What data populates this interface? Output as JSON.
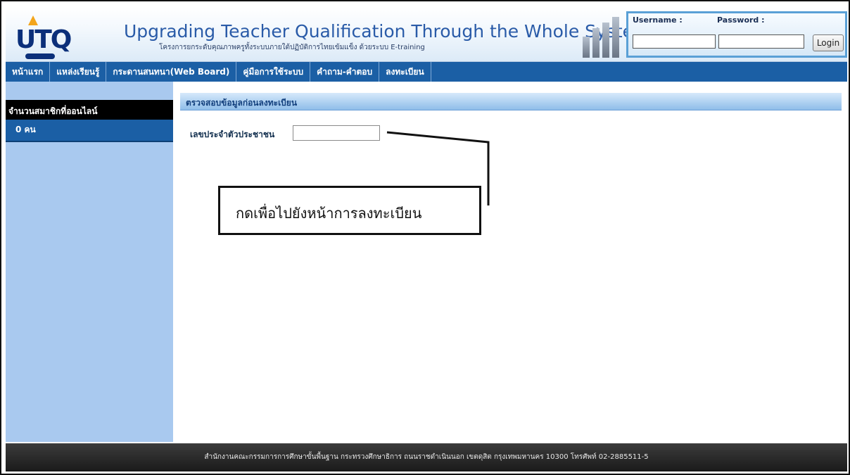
{
  "header": {
    "logo_text": "UTQ",
    "title": "Upgrading Teacher Qualification Through the Whole System",
    "subtitle": "โครงการยกระดับคุณภาพครูทั้งระบบภายใต้ปฏิบัติการไทยเข้มแข็ง ด้วยระบบ E-training",
    "login": {
      "username_label": "Username :",
      "password_label": "Password :",
      "username_value": "",
      "password_value": "",
      "login_button": "Login"
    }
  },
  "nav": {
    "items": [
      {
        "label": "หน้าแรก"
      },
      {
        "label": "แหล่งเรียนรู้"
      },
      {
        "label": "กระดานสนทนา(Web Board)"
      },
      {
        "label": "คู่มือการใช้ระบบ"
      },
      {
        "label": "คำถาม-คำตอบ"
      },
      {
        "label": "ลงทะเบียน"
      }
    ]
  },
  "sidebar": {
    "online_heading": "จำนวนสมาชิกที่ออนไลน์",
    "online_count": "0 คน"
  },
  "main": {
    "section_title": "ตรวจสอบข้อมูลก่อนลงทะเบียน",
    "id_label": "เลขประจำตัวประชาชน",
    "id_value": "",
    "callout": "กดเพื่อไปยังหน้าการลงทะเบียน"
  },
  "footer": {
    "text": "สำนักงานคณะกรรมการการศึกษาขั้นพื้นฐาน กระทรวงศึกษาธิการ ถนนราชดำเนินนอก เขตดุสิต กรุงเทพมหานคร 10300 โทรศัพท์ 02-2885511-5"
  },
  "colors": {
    "nav": "#1b5fa5",
    "sidebar": "#a9c9ef",
    "section_bar": "#8fbde9",
    "footer": "#1a1a1a"
  }
}
